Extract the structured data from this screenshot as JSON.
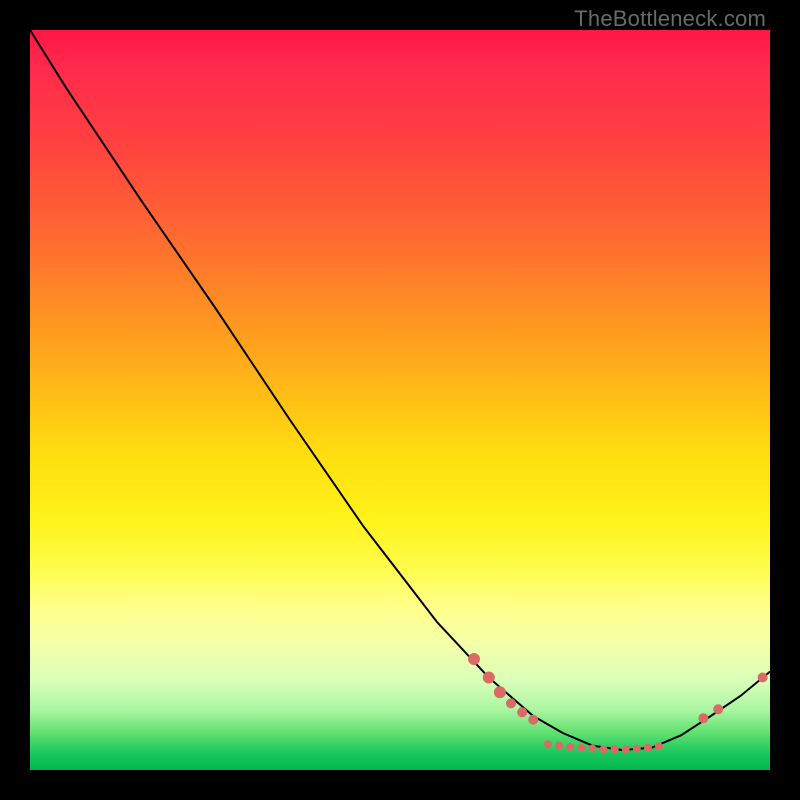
{
  "watermark": "TheBottleneck.com",
  "colors": {
    "curve": "#000000",
    "beads": "#d96a64",
    "gradient_top": "#ff1744",
    "gradient_bottom": "#00b84a"
  },
  "chart_data": {
    "type": "line",
    "title": "",
    "xlabel": "",
    "ylabel": "",
    "xlim": [
      0,
      100
    ],
    "ylim": [
      0,
      100
    ],
    "comment": "x,y in 0..100 plot-area units; y=0 is bottom. Curve is the black bottleneck line; beads are the salmon marker cluster near the minimum.",
    "curve": [
      {
        "x": 0.0,
        "y": 100.0
      },
      {
        "x": 5.0,
        "y": 92.0
      },
      {
        "x": 9.0,
        "y": 86.0
      },
      {
        "x": 15.0,
        "y": 77.0
      },
      {
        "x": 25.0,
        "y": 62.5
      },
      {
        "x": 35.0,
        "y": 47.5
      },
      {
        "x": 45.0,
        "y": 33.0
      },
      {
        "x": 55.0,
        "y": 20.0
      },
      {
        "x": 62.0,
        "y": 12.5
      },
      {
        "x": 68.0,
        "y": 7.3
      },
      {
        "x": 72.0,
        "y": 5.0
      },
      {
        "x": 76.0,
        "y": 3.3
      },
      {
        "x": 80.0,
        "y": 2.7
      },
      {
        "x": 84.0,
        "y": 3.0
      },
      {
        "x": 88.0,
        "y": 4.7
      },
      {
        "x": 92.0,
        "y": 7.3
      },
      {
        "x": 96.0,
        "y": 10.0
      },
      {
        "x": 100.0,
        "y": 13.3
      }
    ],
    "beads": [
      {
        "x": 60.0,
        "y": 15.0,
        "r": 6
      },
      {
        "x": 62.0,
        "y": 12.5,
        "r": 6
      },
      {
        "x": 63.5,
        "y": 10.5,
        "r": 6
      },
      {
        "x": 65.0,
        "y": 9.0,
        "r": 5
      },
      {
        "x": 66.5,
        "y": 7.8,
        "r": 5
      },
      {
        "x": 68.0,
        "y": 6.8,
        "r": 5
      },
      {
        "x": 70.0,
        "y": 3.5,
        "r": 4
      },
      {
        "x": 71.5,
        "y": 3.3,
        "r": 4
      },
      {
        "x": 73.0,
        "y": 3.1,
        "r": 4
      },
      {
        "x": 74.5,
        "y": 3.0,
        "r": 4
      },
      {
        "x": 76.0,
        "y": 2.9,
        "r": 4
      },
      {
        "x": 77.5,
        "y": 2.8,
        "r": 4
      },
      {
        "x": 79.0,
        "y": 2.8,
        "r": 4
      },
      {
        "x": 80.5,
        "y": 2.8,
        "r": 4
      },
      {
        "x": 82.0,
        "y": 2.9,
        "r": 4
      },
      {
        "x": 83.5,
        "y": 3.0,
        "r": 4
      },
      {
        "x": 85.0,
        "y": 3.2,
        "r": 4
      },
      {
        "x": 91.0,
        "y": 7.0,
        "r": 5
      },
      {
        "x": 93.0,
        "y": 8.2,
        "r": 5
      },
      {
        "x": 99.0,
        "y": 12.5,
        "r": 5
      }
    ]
  }
}
